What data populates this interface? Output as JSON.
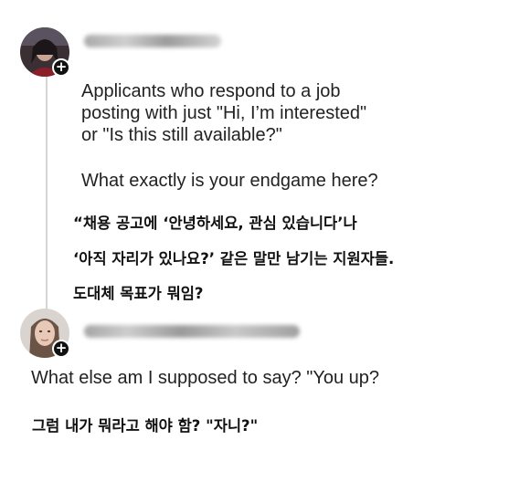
{
  "post1": {
    "avatar": {
      "icon": "user-photo-dark"
    },
    "follow_icon": "+",
    "lines": [
      "Applicants who respond to a job",
      "posting with just \"Hi, I’m interested\"",
      "or \"Is this still available?\""
    ],
    "question": "What exactly is your endgame here?"
  },
  "translation1": {
    "lines": [
      "“채용 공고에 ‘안녕하세요, 관심 있습니다’나",
      "‘아직 자리가 있나요?’ 같은 말만 남기는 지원자들.",
      "도대체 목표가 뭐임?"
    ]
  },
  "post2": {
    "avatar": {
      "icon": "user-photo-light"
    },
    "follow_icon": "+",
    "text": "What else am I supposed to say? \"You up?"
  },
  "translation2": {
    "text": "그럼 내가 뭐라고 해야 함? \"자니?\""
  }
}
